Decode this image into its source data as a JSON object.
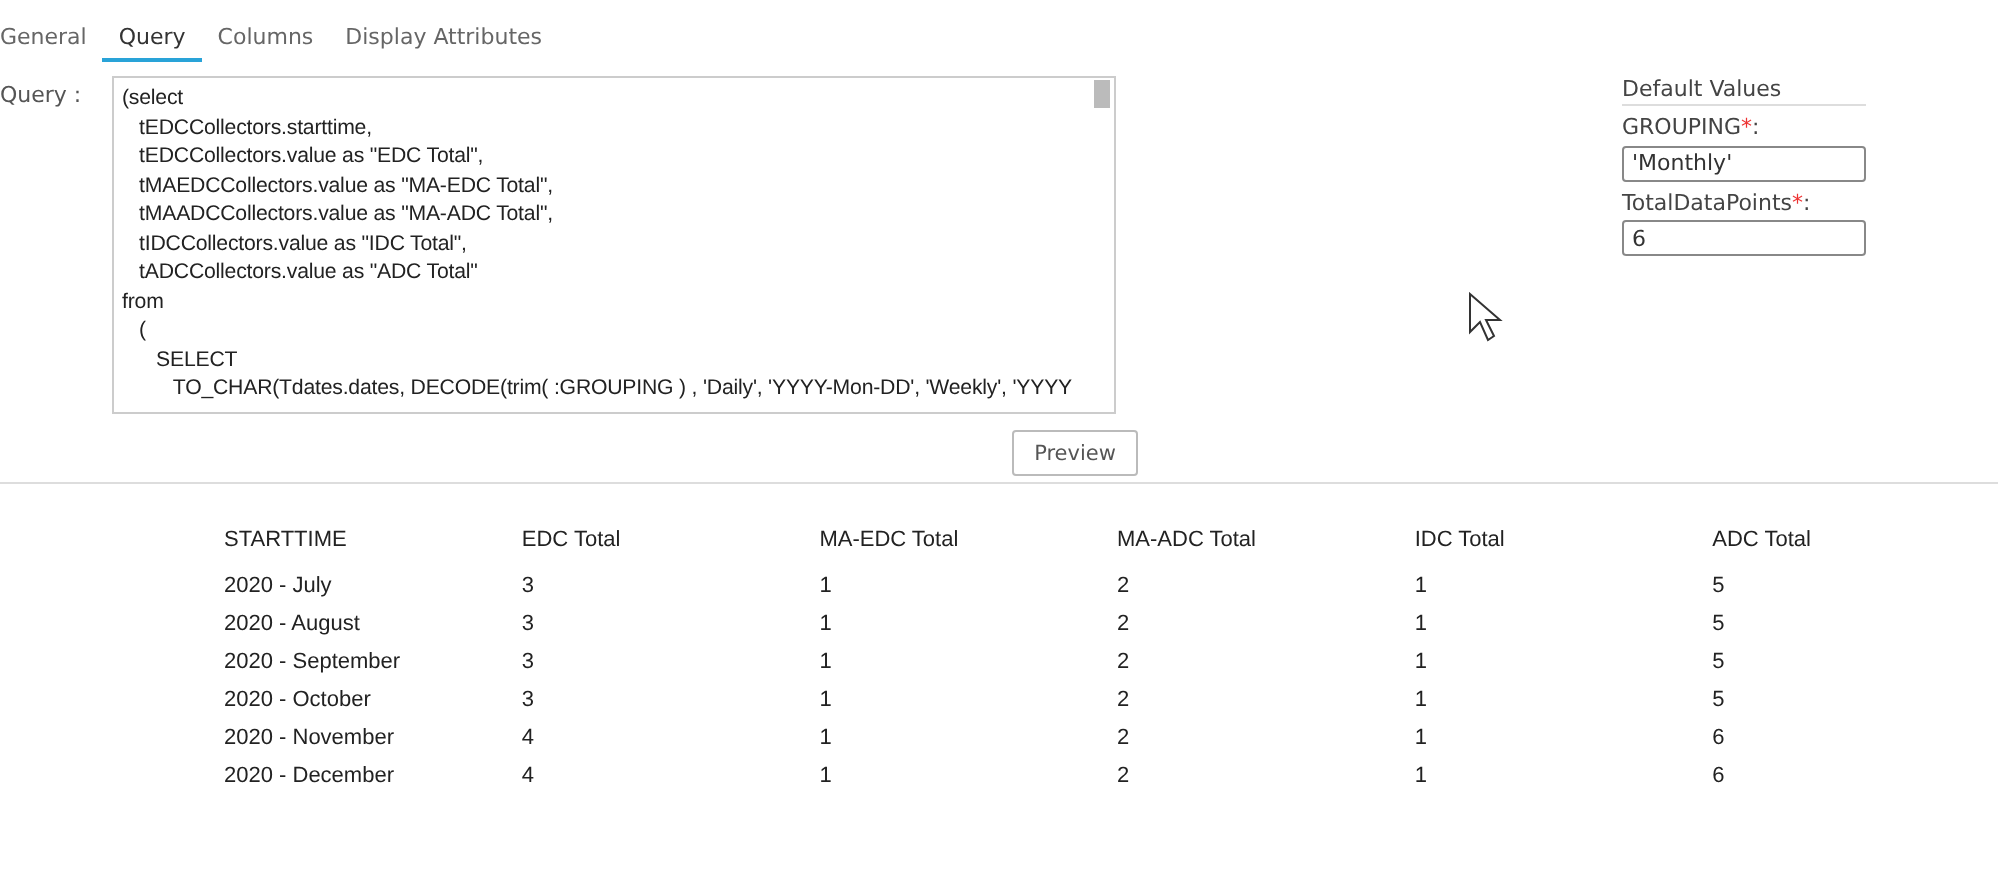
{
  "tabs": [
    {
      "label": "General",
      "selected": false
    },
    {
      "label": "Query",
      "selected": true
    },
    {
      "label": "Columns",
      "selected": false
    },
    {
      "label": "Display Attributes",
      "selected": false
    }
  ],
  "query": {
    "label": "Query :",
    "lines": [
      "(select",
      "   tEDCCollectors.starttime,",
      "   tEDCCollectors.value as \"EDC Total\",",
      "   tMAEDCCollectors.value as \"MA-EDC Total\",",
      "   tMAADCCollectors.value as \"MA-ADC Total\",",
      "   tIDCCollectors.value as \"IDC Total\",",
      "   tADCCollectors.value as \"ADC Total\"",
      "from",
      "   (",
      "      SELECT",
      "         TO_CHAR(Tdates.dates, DECODE(trim( :GROUPING ) , 'Daily', 'YYYY-Mon-DD', 'Weekly', 'YYYY"
    ]
  },
  "default_values": {
    "title": "Default Values",
    "params": [
      {
        "label": "GROUPING",
        "required_mark": "*",
        "suffix": ":",
        "value": "'Monthly'"
      },
      {
        "label": "TotalDataPoints",
        "required_mark": "*",
        "suffix": ":",
        "value": "6"
      }
    ]
  },
  "preview_button": "Preview",
  "table": {
    "columns": [
      "STARTTIME",
      "EDC Total",
      "MA-EDC Total",
      "MA-ADC Total",
      "IDC Total",
      "ADC Total"
    ],
    "rows": [
      [
        "2020 - July",
        "3",
        "1",
        "2",
        "1",
        "5"
      ],
      [
        "2020 - August",
        "3",
        "1",
        "2",
        "1",
        "5"
      ],
      [
        "2020 - September",
        "3",
        "1",
        "2",
        "1",
        "5"
      ],
      [
        "2020 - October",
        "3",
        "1",
        "2",
        "1",
        "5"
      ],
      [
        "2020 - November",
        "4",
        "1",
        "2",
        "1",
        "6"
      ],
      [
        "2020 - December",
        "4",
        "1",
        "2",
        "1",
        "6"
      ]
    ]
  }
}
